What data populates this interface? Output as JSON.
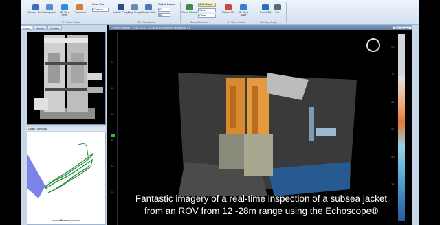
{
  "ribbon": {
    "buttons": [
      {
        "label": "Render Style",
        "color": "#3f6fb5"
      },
      {
        "label": "Viewpoint",
        "color": "#5a8ad0"
      },
      {
        "label": "3D View Style",
        "color": "#2e8fd6"
      },
      {
        "label": "Projection",
        "color": "#e07a30"
      },
      {
        "label": "Visible Pings",
        "color": "#2a4b8a"
      },
      {
        "label": "Ping Shape",
        "color": "#6a8ab8"
      },
      {
        "label": "Show / Hide",
        "color": "#4a7ab8"
      },
      {
        "label": "Show Mosaic",
        "color": "#3c8c4a"
      },
      {
        "label": "Rotate 3D",
        "color": "#c84a3a"
      },
      {
        "label": "3D View Style",
        "color": "#3a7ad0"
      },
      {
        "label": "Reset 3D",
        "color": "#2e6cc0"
      },
      {
        "label": "Pan",
        "color": "#5a6a7a"
      }
    ],
    "point_size_label": "Point Size",
    "point_size_value": "Custom",
    "visible_beams_label": "Visible Beams",
    "beam_values": [
      "63",
      "63"
    ],
    "mosaic_actions": [
      "Add Pings",
      "Save",
      "Clear"
    ],
    "groups": [
      "3D View Styles",
      "3D View Items",
      "Manual Mosaic",
      "3D View Styles",
      "Viewing Angle"
    ]
  },
  "left_panel": {
    "tabs": [
      "View",
      "Mosaic",
      "Models"
    ],
    "nav_title": "Chart Overview",
    "scale_label": "50 m"
  },
  "main_view": {
    "title": "Current Dataset - 2011-06-03_12:46:31 Echoscope Mosaicing 01",
    "fullscreen_label": "Full Screen",
    "ruler_ticks": [
      "50",
      "45",
      "40",
      "35",
      "30",
      "25"
    ],
    "colorbar_ticks": [
      "75",
      "70",
      "60",
      "50",
      "40",
      "35"
    ],
    "caption": {
      "line1": "Fantastic imagery of a real-time inspection of a subsea jacket",
      "line2": "from an ROV from 12 -28m range using the Echoscope®"
    }
  }
}
